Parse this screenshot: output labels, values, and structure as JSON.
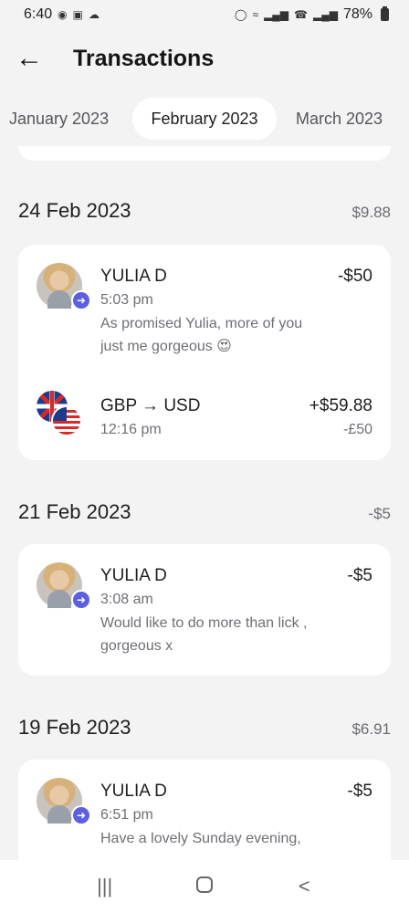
{
  "status_bar": {
    "time": "6:40",
    "battery": "78%",
    "left_icons": [
      "message-icon",
      "gallery-icon",
      "cloud-icon"
    ],
    "right_icons": [
      "vpn-key-icon",
      "wifi-icon",
      "signal-icon",
      "wifi-calling-icon",
      "signal-icon",
      "battery-icon"
    ]
  },
  "header": {
    "back_icon": "←",
    "title": "Transactions"
  },
  "tabs": [
    {
      "label": "January 2023",
      "selected": false
    },
    {
      "label": "February 2023",
      "selected": true
    },
    {
      "label": "March 2023",
      "selected": false
    }
  ],
  "groups": [
    {
      "date": "24 Feb 2023",
      "total": "$9.88",
      "transactions": [
        {
          "name": "YULIA D",
          "time": "5:03 pm",
          "note": "As promised Yulia,  more of you just me gorgeous 😍",
          "amount": "-$50",
          "icon": "avatar"
        },
        {
          "name": "GBP → USD",
          "time": "12:16 pm",
          "amount": "+$59.88",
          "sub_amount": "-£50",
          "icon": "flags-gbp-usd"
        }
      ]
    },
    {
      "date": "21 Feb 2023",
      "total": "-$5",
      "transactions": [
        {
          "name": "YULIA D",
          "time": "3:08 am",
          "note": "Would like to do more than lick , gorgeous x",
          "amount": "-$5",
          "icon": "avatar"
        }
      ]
    },
    {
      "date": "19 Feb 2023",
      "total": "$6.91",
      "transactions": [
        {
          "name": "YULIA D",
          "time": "6:51 pm",
          "note": "Have a lovely Sunday evening,",
          "amount": "-$5",
          "icon": "avatar"
        }
      ]
    }
  ],
  "nav_bar": {
    "recents_icon": "|||",
    "back_icon": "<"
  },
  "colors": {
    "background": "#f3f3f4",
    "card": "#ffffff",
    "badge": "#5b5fe0",
    "muted_text": "#6e6f75"
  }
}
